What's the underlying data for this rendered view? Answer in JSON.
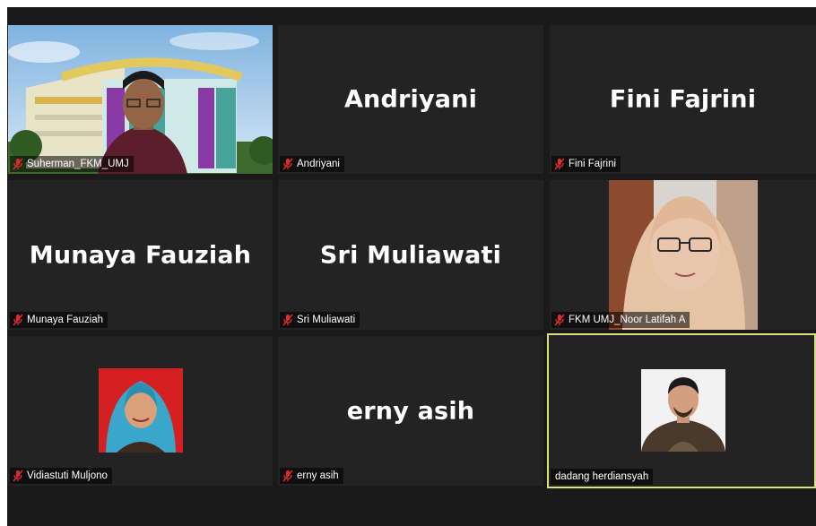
{
  "participants": [
    {
      "display_name": "Suherman_FKM_UMJ",
      "muted": true,
      "video": "building-background"
    },
    {
      "display_name": "Andriyani",
      "big_name": "Andriyani",
      "muted": true
    },
    {
      "display_name": "Fini Fajrini",
      "big_name": "Fini Fajrini",
      "muted": true
    },
    {
      "display_name": "Munaya Fauziah",
      "big_name": "Munaya Fauziah",
      "muted": true
    },
    {
      "display_name": "Sri Muliawati",
      "big_name": "Sri Muliawati",
      "muted": true
    },
    {
      "display_name": "FKM UMJ_Noor Latifah A",
      "muted": true,
      "video": "portrait-hijab"
    },
    {
      "display_name": "Vidiastuti Muljono",
      "muted": true,
      "video": "portrait-red-bg"
    },
    {
      "display_name": "erny asih",
      "big_name": "erny asih",
      "muted": true
    },
    {
      "display_name": "dadang herdiansyah",
      "muted": false,
      "active_speaker": true,
      "video": "portrait-white-bg"
    }
  ],
  "colors": {
    "tile_bg": "#232323",
    "active_border": "#d9e27a",
    "muted_icon": "#e02b2b",
    "label_text": "#ffffff"
  },
  "icons": {
    "muted": "mic-muted-icon"
  }
}
